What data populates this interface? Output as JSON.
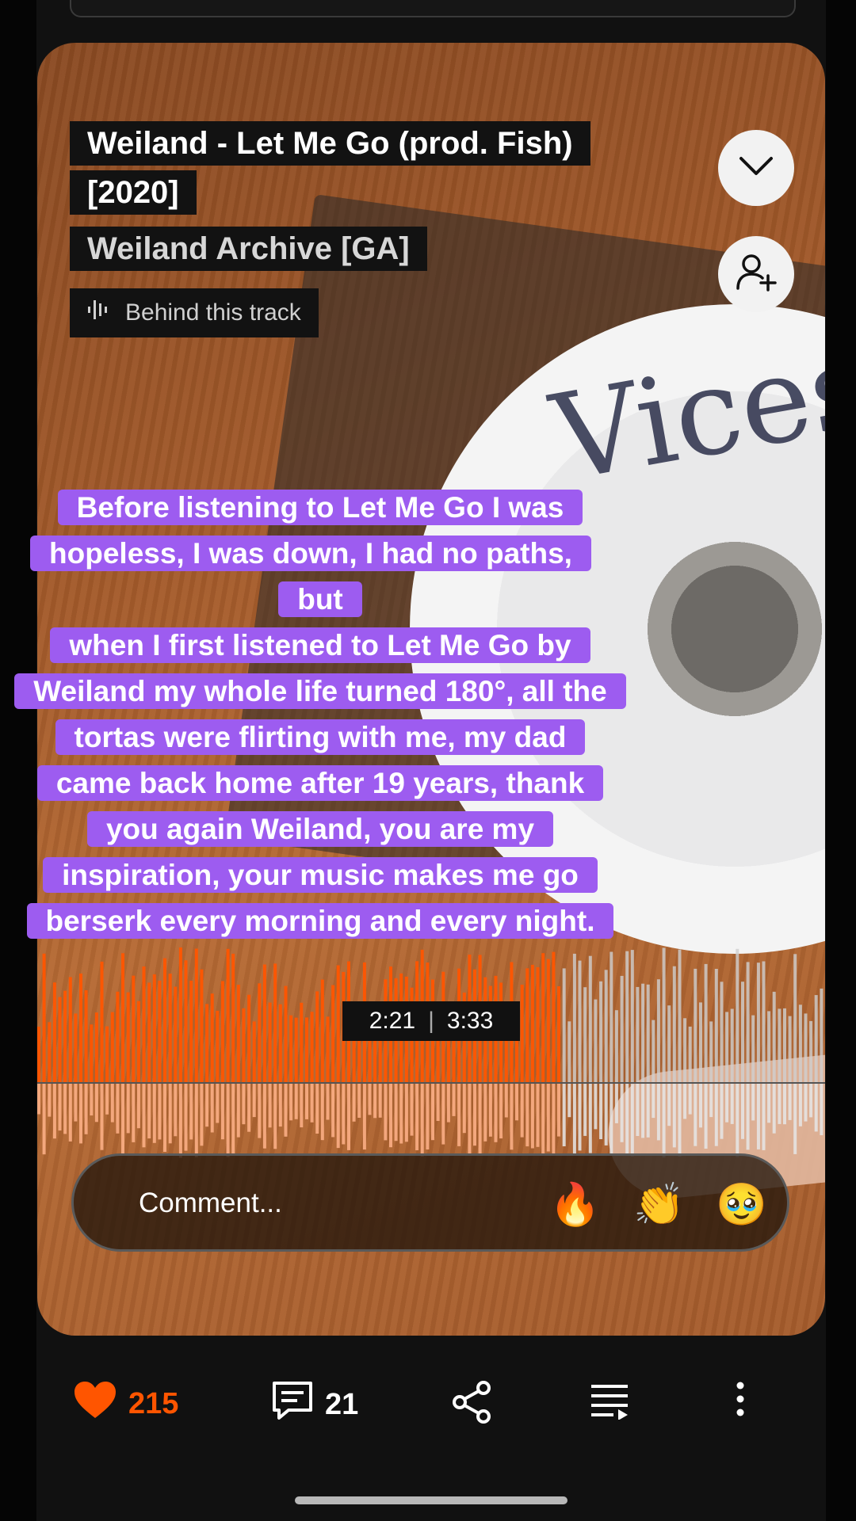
{
  "track": {
    "title": "Weiland - Let Me Go (prod. Fish) [2020]",
    "artist": "Weiland Archive [GA]",
    "behind_label": "Behind this track"
  },
  "cover": {
    "disc_text": "Vices"
  },
  "caption": {
    "lines": [
      "Before listening to Let Me Go I was",
      "hopeless, I was down, I had no paths, but",
      "when I first listened to Let Me Go by",
      "Weiland my whole life turned 180°, all the",
      "tortas were flirting with me, my dad",
      "came back home after 19 years, thank",
      "you again Weiland, you are my",
      "inspiration, your music makes me go",
      "berserk every morning and every night."
    ]
  },
  "player": {
    "current_time": "2:21",
    "separator": "|",
    "duration": "3:33",
    "progress": 0.6624,
    "played_color": "#ff5500",
    "unplayed_color": "#d0d0d0"
  },
  "comment": {
    "placeholder": "Comment...",
    "reactions": [
      "🔥",
      "👏",
      "🥹"
    ]
  },
  "actions": {
    "likes": "215",
    "comments": "21",
    "icons": [
      "heart-icon",
      "comment-icon",
      "share-icon",
      "queue-icon",
      "more-icon"
    ],
    "accent": "#ff5500"
  }
}
